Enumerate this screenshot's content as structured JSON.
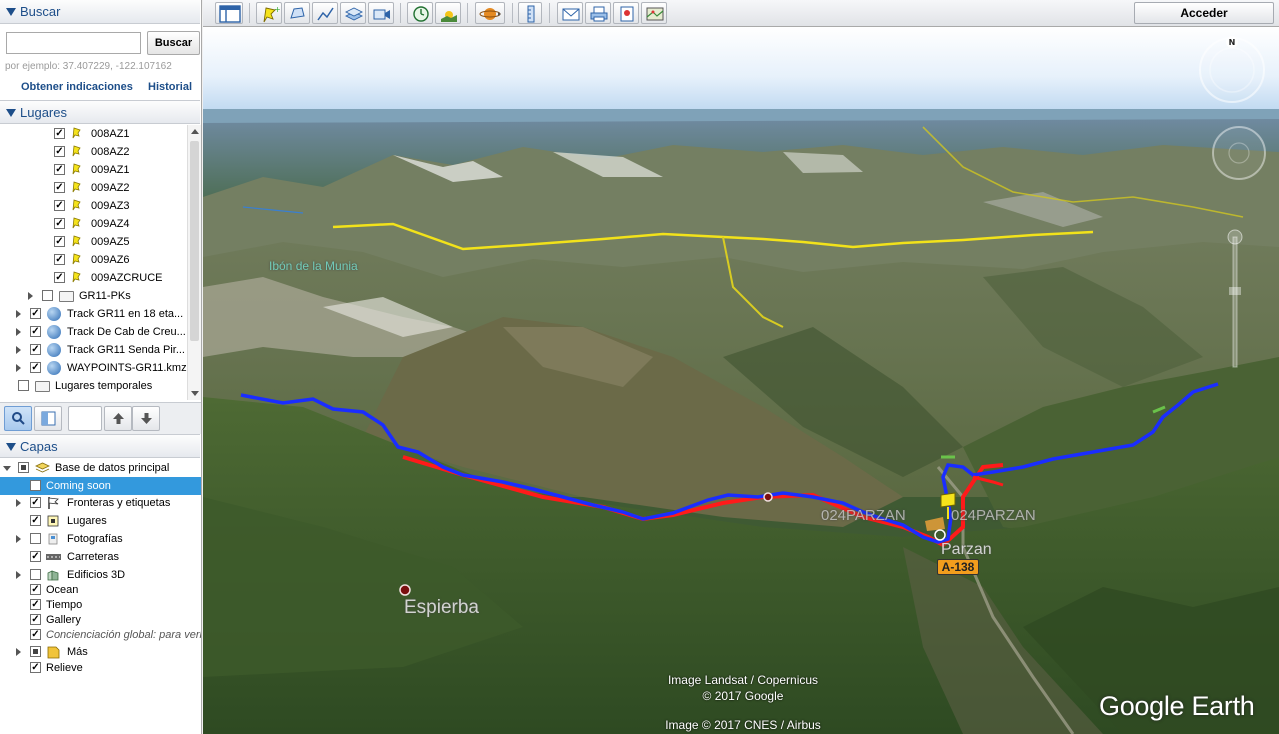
{
  "search": {
    "title": "Buscar",
    "input_value": "",
    "button_label": "Buscar",
    "example": "por ejemplo: 37.407229, -122.107162",
    "directions_link": "Obtener indicaciones",
    "history_link": "Historial"
  },
  "places": {
    "title": "Lugares",
    "items": [
      {
        "label": "008AZ1",
        "checked": true,
        "icon": "yellow-pushpin-icon"
      },
      {
        "label": "008AZ2",
        "checked": true,
        "icon": "yellow-pushpin-icon"
      },
      {
        "label": "009AZ1",
        "checked": true,
        "icon": "yellow-pushpin-icon"
      },
      {
        "label": "009AZ2",
        "checked": true,
        "icon": "yellow-pushpin-icon"
      },
      {
        "label": "009AZ3",
        "checked": true,
        "icon": "yellow-pushpin-icon"
      },
      {
        "label": "009AZ4",
        "checked": true,
        "icon": "yellow-pushpin-icon"
      },
      {
        "label": "009AZ5",
        "checked": true,
        "icon": "yellow-pushpin-icon"
      },
      {
        "label": "009AZ6",
        "checked": true,
        "icon": "yellow-pushpin-icon"
      },
      {
        "label": "009AZCRUCE",
        "checked": true,
        "icon": "yellow-pushpin-icon"
      },
      {
        "label": "GR11-PKs",
        "checked": false,
        "icon": "folder-icon"
      },
      {
        "label": "Track GR11 en 18 eta...",
        "checked": true,
        "icon": "kml-globe-icon"
      },
      {
        "label": "Track De Cab de Creu...",
        "checked": true,
        "icon": "kml-globe-icon"
      },
      {
        "label": "Track GR11 Senda Pir...",
        "checked": true,
        "icon": "kml-globe-icon"
      },
      {
        "label": "WAYPOINTS-GR11.kmz",
        "checked": true,
        "icon": "kml-globe-icon"
      },
      {
        "label": "Lugares temporales",
        "checked": false,
        "icon": "folder-icon"
      }
    ]
  },
  "layers": {
    "title": "Capas",
    "items": [
      {
        "label": "Base de datos principal",
        "checked": "partial",
        "icon": "layers-db-icon"
      },
      {
        "label": "Coming soon",
        "checked": false,
        "selected": true
      },
      {
        "label": "Fronteras y etiquetas",
        "checked": true,
        "icon": "borders-flag-icon"
      },
      {
        "label": "Lugares",
        "checked": true,
        "icon": "places-icon"
      },
      {
        "label": "Fotografías",
        "checked": false,
        "icon": "photos-icon"
      },
      {
        "label": "Carreteras",
        "checked": true,
        "icon": "roads-icon"
      },
      {
        "label": "Edificios 3D",
        "checked": false,
        "icon": "buildings-3d-icon"
      },
      {
        "label": "Ocean",
        "checked": true
      },
      {
        "label": "Tiempo",
        "checked": true
      },
      {
        "label": "Gallery",
        "checked": true
      },
      {
        "label": "Concienciación global: para verlo",
        "checked": true,
        "italic": true
      },
      {
        "label": "Más",
        "checked": "partial",
        "icon": "more-icon"
      },
      {
        "label": "Relieve",
        "checked": true
      }
    ]
  },
  "toolbar": {
    "signin_label": "Acceder"
  },
  "map": {
    "place_labels": {
      "espierba": "Espierba",
      "parzan": "Parzan",
      "pk1": "024PARZAN",
      "pk2": "024PARZAN",
      "lake": "Ibón de la Munia"
    },
    "road_badge": "A-138",
    "attribution_1": "Image Landsat / Copernicus",
    "attribution_2": "© 2017 Google",
    "attribution_3": "Image © 2017 CNES / Airbus",
    "logo": "Google Earth",
    "compass_north": "N",
    "colors": {
      "track_blue": "#1a2dff",
      "track_red": "#ff1a1a",
      "border_yellow": "#f2e21a",
      "accent": "#1d4e89"
    }
  }
}
